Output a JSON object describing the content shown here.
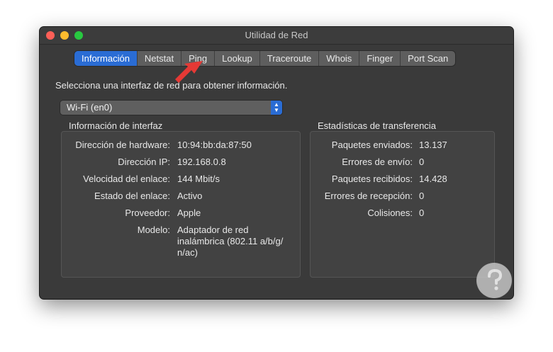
{
  "window": {
    "title": "Utilidad de Red"
  },
  "tabs": [
    {
      "label": "Información",
      "active": true
    },
    {
      "label": "Netstat",
      "active": false
    },
    {
      "label": "Ping",
      "active": false
    },
    {
      "label": "Lookup",
      "active": false
    },
    {
      "label": "Traceroute",
      "active": false
    },
    {
      "label": "Whois",
      "active": false
    },
    {
      "label": "Finger",
      "active": false
    },
    {
      "label": "Port Scan",
      "active": false
    }
  ],
  "instruction": "Selecciona una interfaz de red para obtener información.",
  "interface_select": {
    "value": "Wi-Fi (en0)"
  },
  "interface_info": {
    "title": "Información de interfaz",
    "rows": [
      {
        "label": "Dirección de hardware:",
        "value": "10:94:bb:da:87:50"
      },
      {
        "label": "Dirección IP:",
        "value": "192.168.0.8"
      },
      {
        "label": "Velocidad del enlace:",
        "value": "144 Mbit/s"
      },
      {
        "label": "Estado del enlace:",
        "value": "Activo"
      },
      {
        "label": "Proveedor:",
        "value": "Apple"
      },
      {
        "label": "Modelo:",
        "value_lines": [
          "Adaptador de red",
          "inalámbrica (802.11 a/b/g/",
          "n/ac)"
        ]
      }
    ]
  },
  "transfer_stats": {
    "title": "Estadísticas de transferencia",
    "rows": [
      {
        "label": "Paquetes enviados:",
        "value": "13.137"
      },
      {
        "label": "Errores de envío:",
        "value": "0"
      },
      {
        "label": "Paquetes recibidos:",
        "value": "14.428"
      },
      {
        "label": "Errores de recepción:",
        "value": "0"
      },
      {
        "label": "Colisiones:",
        "value": "0"
      }
    ]
  },
  "colors": {
    "accent": "#2a6cd4",
    "annotation_arrow": "#e53935"
  },
  "icons": [
    "close-icon",
    "minimize-icon",
    "zoom-icon",
    "updown-chevron-icon",
    "annotation-arrow",
    "watermark-logo"
  ]
}
